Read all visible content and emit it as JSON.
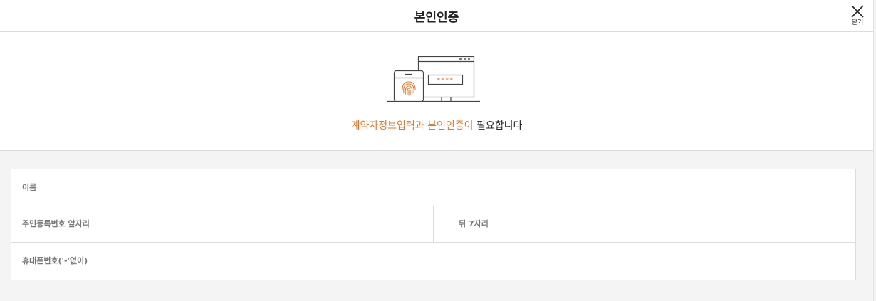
{
  "header": {
    "title": "본인인증",
    "close_label": "닫기"
  },
  "intro": {
    "message_accent": "계약자정보입력과 본인인증이",
    "message_rest": " 필요합니다",
    "illustration": {
      "password_mask": "****",
      "accent_color": "#e8762b"
    }
  },
  "form": {
    "name": {
      "placeholder": "이름",
      "value": ""
    },
    "rrn_front": {
      "placeholder": "주민등록번호 앞자리",
      "value": ""
    },
    "rrn_back": {
      "placeholder": "뒤 7자리",
      "value": ""
    },
    "phone": {
      "placeholder": "휴대폰번호('-'없이)",
      "value": ""
    }
  },
  "colors": {
    "accent": "#e8762b",
    "background": "#f4f4f4",
    "border": "#dcdcdc"
  }
}
